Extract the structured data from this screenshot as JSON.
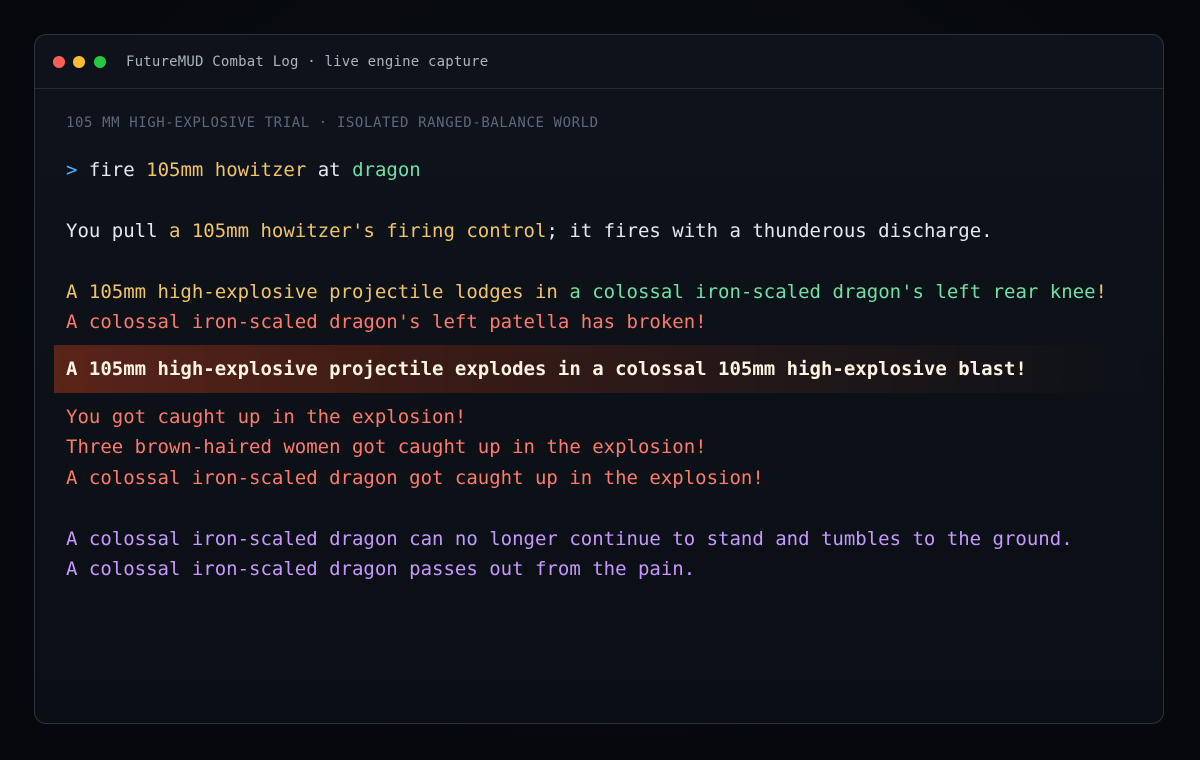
{
  "window": {
    "title": "FutureMUD Combat Log · live engine capture"
  },
  "log": {
    "subheading": "105 MM HIGH-EXPLOSIVE TRIAL · ISOLATED RANGED-BALANCE WORLD",
    "command": {
      "prompt": ">",
      "verb": "fire",
      "weapon": "105mm howitzer",
      "connector": "at",
      "target": "dragon"
    },
    "fire_line": {
      "lead": "You pull ",
      "control": "a 105mm howitzer's firing control",
      "tail": "; it fires with a thunderous discharge."
    },
    "lodge_line": {
      "projectile": "A 105mm high-explosive projectile lodges in",
      "spacer": " ",
      "location": "a colossal iron-scaled dragon's left rear knee",
      "end": "!"
    },
    "break_line": "A colossal iron-scaled dragon's left patella has broken!",
    "blast_line": "A 105mm high-explosive projectile explodes in a colossal 105mm high-explosive blast!",
    "caught_lines": [
      "You got caught up in the explosion!",
      "Three brown-haired women got caught up in the explosion!",
      "A colossal iron-scaled dragon got caught up in the explosion!"
    ],
    "status_lines": [
      "A colossal iron-scaled dragon can no longer continue to stand and tumbles to the ground.",
      "A colossal iron-scaled dragon passes out from the pain."
    ]
  },
  "colors": {
    "prompt": "#4ab3ff",
    "weapon": "#f2c46a",
    "target": "#6fe0a6",
    "damage": "#ff7a6a",
    "status": "#c699ff",
    "blast_text": "#fff4e2"
  }
}
